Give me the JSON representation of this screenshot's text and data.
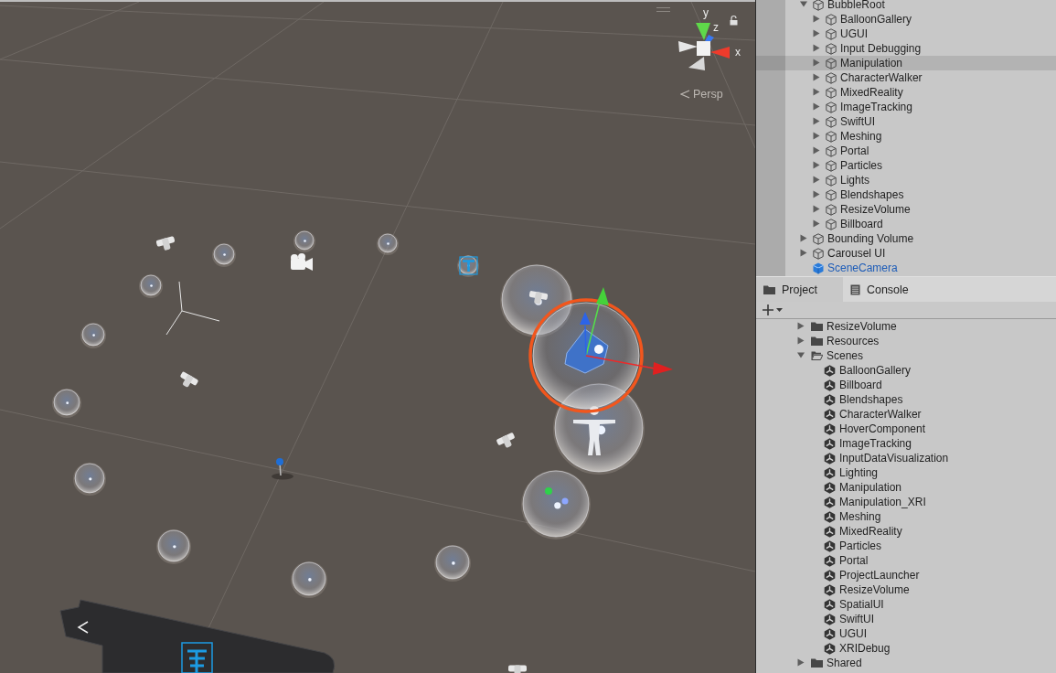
{
  "scene_view": {
    "gizmo_axes": [
      {
        "label": "y"
      },
      {
        "label": "z"
      },
      {
        "label": "x"
      }
    ],
    "projection": "Persp"
  },
  "hierarchy": {
    "items": [
      {
        "label": "BubbleRoot",
        "kind": "object",
        "expanded": true,
        "selected": false,
        "children": [
          {
            "label": "BalloonGallery",
            "kind": "object",
            "expanded": false,
            "selected": false
          },
          {
            "label": "UGUI",
            "kind": "object",
            "expanded": false,
            "selected": false
          },
          {
            "label": "Input Debugging",
            "kind": "object",
            "expanded": false,
            "selected": false
          },
          {
            "label": "Manipulation",
            "kind": "object",
            "expanded": false,
            "selected": true
          },
          {
            "label": "CharacterWalker",
            "kind": "object",
            "expanded": false,
            "selected": false
          },
          {
            "label": "MixedReality",
            "kind": "object",
            "expanded": false,
            "selected": false
          },
          {
            "label": "ImageTracking",
            "kind": "object",
            "expanded": false,
            "selected": false
          },
          {
            "label": "SwiftUI",
            "kind": "object",
            "expanded": false,
            "selected": false
          },
          {
            "label": "Meshing",
            "kind": "object",
            "expanded": false,
            "selected": false
          },
          {
            "label": "Portal",
            "kind": "object",
            "expanded": false,
            "selected": false
          },
          {
            "label": "Particles",
            "kind": "object",
            "expanded": false,
            "selected": false
          },
          {
            "label": "Lights",
            "kind": "object",
            "expanded": false,
            "selected": false
          },
          {
            "label": "Blendshapes",
            "kind": "object",
            "expanded": false,
            "selected": false
          },
          {
            "label": "ResizeVolume",
            "kind": "object",
            "expanded": false,
            "selected": false
          },
          {
            "label": "Billboard",
            "kind": "object",
            "expanded": false,
            "selected": false
          }
        ]
      },
      {
        "label": "Bounding Volume",
        "kind": "object",
        "expanded": false,
        "selected": false
      },
      {
        "label": "Carousel UI",
        "kind": "object",
        "expanded": false,
        "selected": false
      },
      {
        "label": "SceneCamera",
        "kind": "prefab",
        "selected": false
      }
    ]
  },
  "project_panel": {
    "tabs": [
      {
        "label": "Project",
        "selected": true
      },
      {
        "label": "Console",
        "selected": false
      }
    ],
    "tree": [
      {
        "label": "ResizeVolume",
        "kind": "folder",
        "expanded": false
      },
      {
        "label": "Resources",
        "kind": "folder",
        "expanded": false
      },
      {
        "label": "Scenes",
        "kind": "folder",
        "expanded": true,
        "children": [
          {
            "label": "BalloonGallery",
            "kind": "scene"
          },
          {
            "label": "Billboard",
            "kind": "scene"
          },
          {
            "label": "Blendshapes",
            "kind": "scene"
          },
          {
            "label": "CharacterWalker",
            "kind": "scene"
          },
          {
            "label": "HoverComponent",
            "kind": "scene"
          },
          {
            "label": "ImageTracking",
            "kind": "scene"
          },
          {
            "label": "InputDataVisualization",
            "kind": "scene"
          },
          {
            "label": "Lighting",
            "kind": "scene"
          },
          {
            "label": "Manipulation",
            "kind": "scene"
          },
          {
            "label": "Manipulation_XRI",
            "kind": "scene"
          },
          {
            "label": "Meshing",
            "kind": "scene"
          },
          {
            "label": "MixedReality",
            "kind": "scene"
          },
          {
            "label": "Particles",
            "kind": "scene"
          },
          {
            "label": "Portal",
            "kind": "scene"
          },
          {
            "label": "ProjectLauncher",
            "kind": "scene"
          },
          {
            "label": "ResizeVolume",
            "kind": "scene"
          },
          {
            "label": "SpatialUI",
            "kind": "scene"
          },
          {
            "label": "SwiftUI",
            "kind": "scene"
          },
          {
            "label": "UGUI",
            "kind": "scene"
          },
          {
            "label": "XRIDebug",
            "kind": "scene"
          }
        ]
      },
      {
        "label": "Shared",
        "kind": "folder",
        "expanded": false
      }
    ]
  }
}
